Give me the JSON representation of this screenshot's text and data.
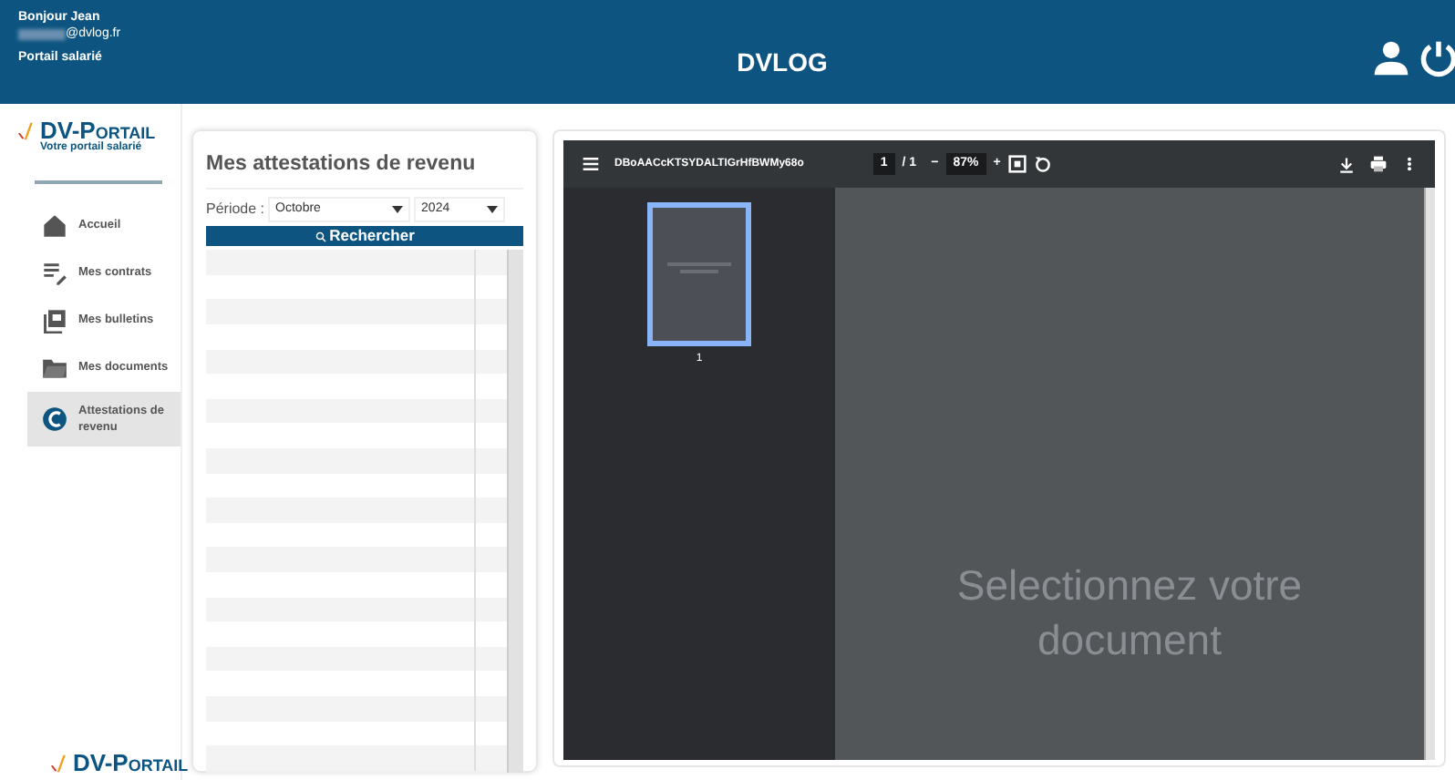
{
  "header": {
    "greeting": "Bonjour Jean",
    "email": "@dvlog.fr",
    "portal": "Portail salarié",
    "title": "DVLOG"
  },
  "logo": {
    "name": "DV-Portail",
    "tagline": "Votre portail salarié"
  },
  "nav": [
    {
      "label": "Accueil",
      "kind": "home",
      "selected": false
    },
    {
      "label": "Mes contrats",
      "kind": "contracts",
      "selected": false
    },
    {
      "label": "Mes bulletins",
      "kind": "bulletins",
      "selected": false
    },
    {
      "label": "Mes documents",
      "kind": "folder",
      "selected": false
    },
    {
      "label": "Attestations de revenu",
      "kind": "euro",
      "selected": true
    }
  ],
  "footer_logo": {
    "name": "DV-Portail"
  },
  "panel": {
    "title": "Mes attestations de revenu",
    "period_label": "Période :",
    "month": "Octobre",
    "year": "2024",
    "search_button": "Rechercher"
  },
  "viewer": {
    "filename": "DBoAACcKTSYDALTIGrHfBWMy68o",
    "page": "1",
    "page_total": "/ 1",
    "minus": "−",
    "zoom": "87%",
    "plus": "+",
    "thumbnails": [
      {
        "label": "1",
        "selected": true
      }
    ],
    "message": "Selectionnez votre document"
  }
}
